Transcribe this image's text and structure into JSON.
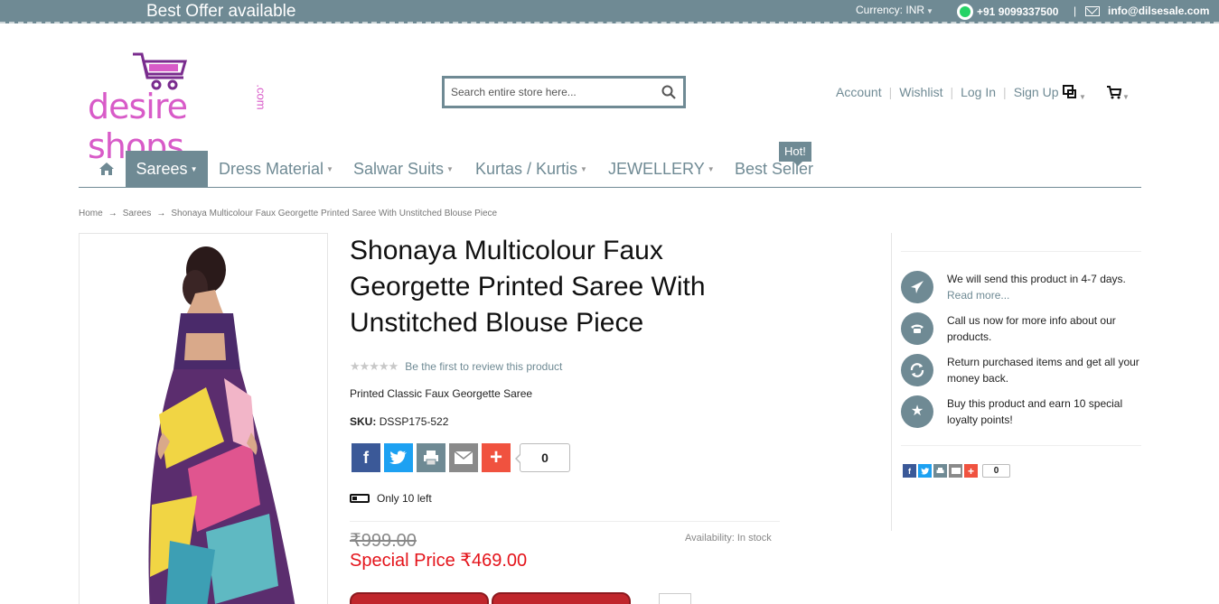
{
  "topbar": {
    "offer": "Best Offer available",
    "currency_label": "Currency:",
    "currency_value": "INR",
    "phone": "+91 9099337500",
    "separator": "|",
    "email": "info@dilsesale.com"
  },
  "logo": {
    "main": "desire shops",
    "suffix": ".com"
  },
  "search": {
    "placeholder": "Search entire store here..."
  },
  "header_links": [
    "Account",
    "Wishlist",
    "Log In",
    "Sign Up"
  ],
  "nav": {
    "items": [
      {
        "label": "Sarees"
      },
      {
        "label": "Dress Material"
      },
      {
        "label": "Salwar Suits"
      },
      {
        "label": "Kurtas / Kurtis"
      },
      {
        "label": "JEWELLERY"
      },
      {
        "label": "Best Seller"
      }
    ],
    "hot_badge": "Hot!"
  },
  "breadcrumb": [
    "Home",
    "Sarees",
    "Shonaya Multicolour Faux Georgette Printed Saree With Unstitched Blouse Piece"
  ],
  "product": {
    "title": "Shonaya Multicolour Faux Georgette Printed Saree With Unstitched Blouse Piece",
    "stars": "★★★★★",
    "review_link": "Be the first to review this product",
    "short_desc": "Printed Classic Faux Georgette Saree",
    "sku_label": "SKU:",
    "sku": "DSSP175-522",
    "share_count": "0",
    "stock_note": "Only 10 left",
    "availability": "Availability: In stock",
    "old_price": "₹999.00",
    "special_price": "Special Price ₹469.00"
  },
  "sidebar": {
    "features": [
      {
        "text": "We will send this product in 4-7 days.",
        "link": "Read more...",
        "icon": "airplane-icon"
      },
      {
        "text": "Call us now for more info about our products.",
        "icon": "phone-icon"
      },
      {
        "text": "Return purchased items and get all your money back.",
        "icon": "refresh-icon"
      },
      {
        "text": "Buy this product and earn 10 special loyalty points!",
        "icon": "star-icon"
      }
    ],
    "share_count": "0"
  },
  "colors": {
    "accent": "#6f8a94",
    "price_red": "#e4141b",
    "logo_pink": "#d85bc8"
  }
}
